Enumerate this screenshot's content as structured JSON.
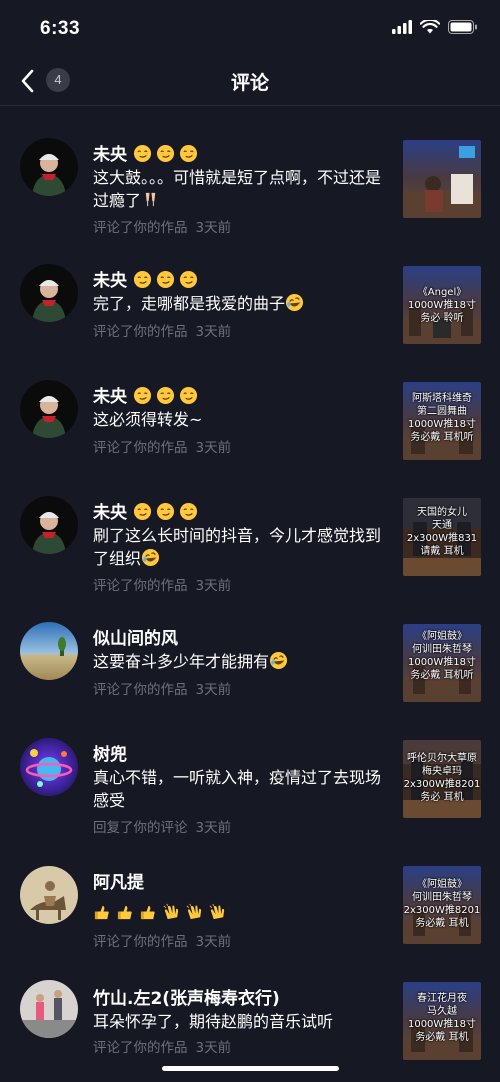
{
  "status": {
    "time": "6:33"
  },
  "nav": {
    "title": "评论",
    "badge": "4"
  },
  "comments": [
    {
      "name": "未央",
      "name_emoji": [
        "smirk",
        "smirk",
        "smirk"
      ],
      "text": "这大鼓。。。可惜就是短了点啊，不过还是过瘾了",
      "text_emoji": "clinking-glasses",
      "action": "评论了你的作品",
      "time": "3天前",
      "avatar": "person-red-cap",
      "thumb_text": ""
    },
    {
      "name": "未央",
      "name_emoji": [
        "smirk",
        "smirk",
        "smirk"
      ],
      "text": "完了，走哪都是我爱的曲子",
      "text_emoji": "rofl",
      "action": "评论了你的作品",
      "time": "3天前",
      "avatar": "person-red-cap",
      "thumb_text": "《Angel》\n1000W推18寸\n务必    聆听"
    },
    {
      "name": "未央",
      "name_emoji": [
        "smirk",
        "smirk",
        "smirk"
      ],
      "text": "这必须得转发~",
      "text_emoji": "",
      "action": "评论了你的作品",
      "time": "3天前",
      "avatar": "person-red-cap",
      "thumb_text": "阿斯塔科维奇\n第二圆舞曲\n1000W推18寸\n务必戴  耳机听"
    },
    {
      "name": "未央",
      "name_emoji": [
        "smirk",
        "smirk",
        "smirk"
      ],
      "text": "刷了这么长时间的抖音，今儿才感觉找到了组织",
      "text_emoji": "rofl",
      "action": "评论了你的作品",
      "time": "3天前",
      "avatar": "person-red-cap",
      "thumb_text": "天国的女儿\n天通\n2x300W推831\n请戴  耳机"
    },
    {
      "name": "似山间的风",
      "name_emoji": [],
      "text": "这要奋斗多少年才能拥有",
      "text_emoji": "rofl",
      "action": "评论了你的作品",
      "time": "3天前",
      "avatar": "landscape",
      "thumb_text": "《阿姐鼓》\n何训田朱哲琴\n1000W推18寸\n务必戴  耳机听"
    },
    {
      "name": "树兜",
      "name_emoji": [],
      "text": "真心不错，一听就入神，疫情过了去现场感受",
      "text_emoji": "",
      "action": "回复了你的评论",
      "time": "3天前",
      "avatar": "cartoon-planet",
      "thumb_text": "呼伦贝尔大草原\n梅央卓玛\n2x300W推8201\n务必    耳机"
    },
    {
      "name": "阿凡提",
      "name_emoji": [],
      "text": "",
      "text_emoji": "thumbs-clap-row",
      "action": "评论了你的作品",
      "time": "3天前",
      "avatar": "donkey-rider",
      "thumb_text": "《阿姐鼓》\n何训田朱哲琴\n2x300W推8201\n务必戴  耳机"
    },
    {
      "name": "竹山.左2(张声梅寿衣行)",
      "name_emoji": [],
      "text": "耳朵怀孕了，期待赵鹏的音乐试听",
      "text_emoji": "",
      "action": "评论了你的作品",
      "time": "3天前",
      "avatar": "two-people",
      "thumb_text": "春江花月夜\n马久越\n1000W推18寸\n务必戴  耳机"
    }
  ],
  "colors": {
    "background": "#161824",
    "meta": "#6e707c",
    "divider": "#2a2c38"
  }
}
